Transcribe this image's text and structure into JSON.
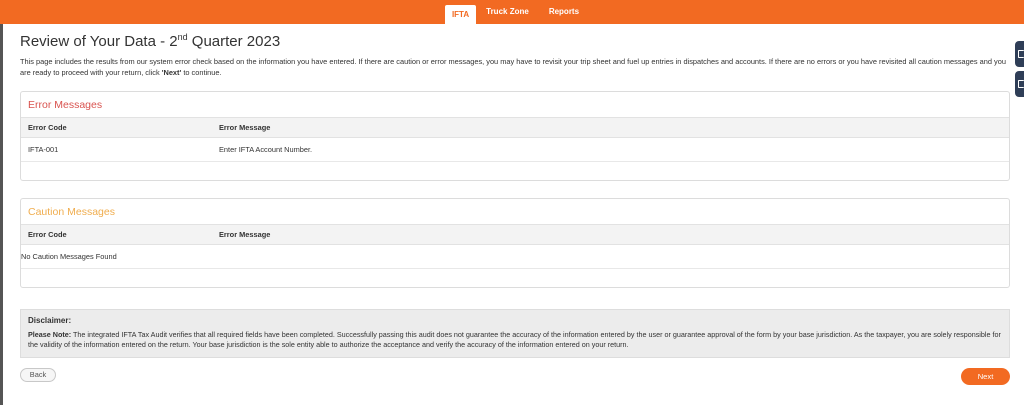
{
  "nav": {
    "tabs": [
      {
        "label": "IFTA",
        "active": true
      },
      {
        "label": "Truck Zone",
        "active": false
      },
      {
        "label": "Reports",
        "active": false
      }
    ]
  },
  "page": {
    "title_prefix": "Review of Your Data - 2",
    "title_sup": "nd",
    "title_suffix": " Quarter 2023",
    "intro_part1": "This page includes the results from our system error check based on the information you have entered. If there are caution or error messages, you may have to revisit your trip sheet and fuel up entries in dispatches and accounts. If there are no errors or you have revisited all caution messages and you are ready to proceed with your return, click ",
    "intro_bold": "'Next'",
    "intro_part2": " to continue."
  },
  "error_panel": {
    "title": "Error Messages",
    "col_code": "Error Code",
    "col_message": "Error Message",
    "rows": [
      {
        "code": "IFTA-001",
        "message": "Enter IFTA Account Number."
      }
    ]
  },
  "caution_panel": {
    "title": "Caution Messages",
    "col_code": "Error Code",
    "col_message": "Error Message",
    "empty_text": "No Caution Messages Found"
  },
  "disclaimer": {
    "title": "Disclaimer:",
    "note_label": "Please Note:",
    "text": " The integrated IFTA Tax Audit verifies that all required fields have been completed. Successfully passing this audit does not guarantee the accuracy of the information entered by the user or guarantee approval of the form by your base jurisdiction. As the taxpayer, you are solely responsible for the validity of the information entered on the return. Your base jurisdiction is the sole entity able to authorize the acceptance and verify the accuracy of the information entered on your return."
  },
  "buttons": {
    "back": "Back",
    "next": "Next"
  },
  "colors": {
    "brand": "#f26a22",
    "error_title": "#d9534f",
    "caution_title": "#f0ad4e"
  }
}
